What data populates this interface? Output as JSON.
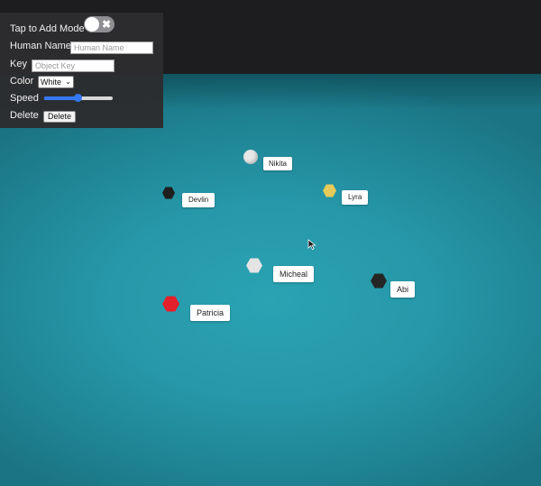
{
  "panel": {
    "add_mode_label": "Tap to Add Mode",
    "add_mode_on": false,
    "toggle_off_glyph": "✖",
    "human_name_label": "Human Name",
    "human_name_placeholder": "Human Name",
    "key_label": "Key",
    "key_placeholder": "Object Key",
    "color_label": "Color",
    "color_selected": "White",
    "speed_label": "Speed",
    "speed_value": 0.5,
    "delete_label": "Delete",
    "delete_button": "Delete"
  },
  "objects": [
    {
      "name": "Nikita",
      "color": "#e8e8e8",
      "shape": "round"
    },
    {
      "name": "Devlin",
      "color": "#1f1f1f",
      "shape": "hex"
    },
    {
      "name": "Lyra",
      "color": "#e6cb5a",
      "shape": "hex"
    },
    {
      "name": "Micheal",
      "color": "#e4e4e4",
      "shape": "hex"
    },
    {
      "name": "Abi",
      "color": "#252525",
      "shape": "hex"
    },
    {
      "name": "Patricia",
      "color": "#e3202c",
      "shape": "hex"
    }
  ],
  "colors": {
    "scene": "#2697a8",
    "panel": "#2c2c2e",
    "accent": "#3478f6"
  }
}
